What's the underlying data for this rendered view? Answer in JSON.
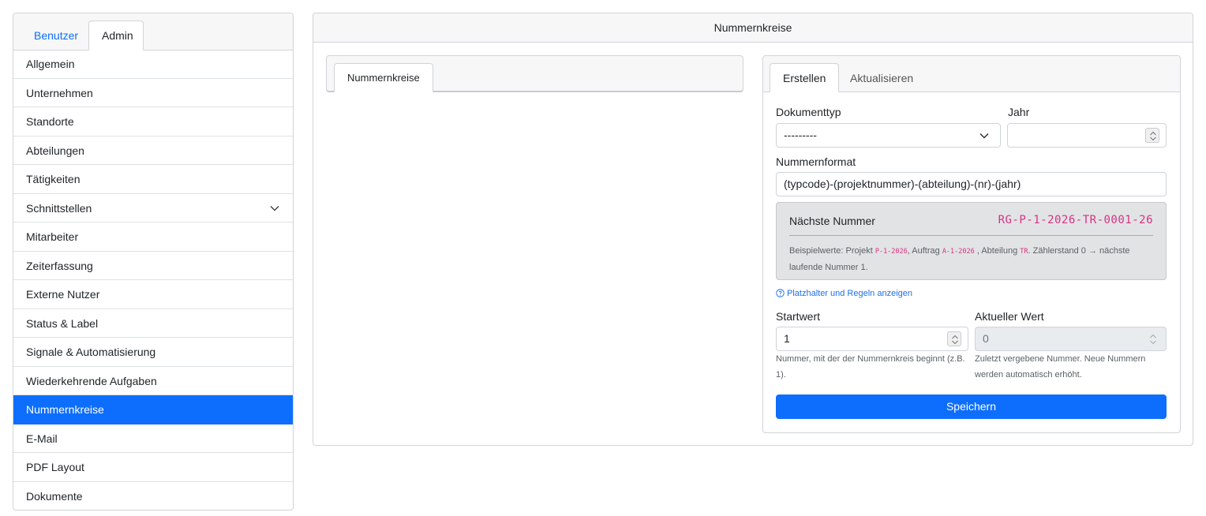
{
  "sidebar": {
    "tabs": [
      {
        "label": "Benutzer",
        "active": false
      },
      {
        "label": "Admin",
        "active": true
      }
    ],
    "items": [
      {
        "label": "Allgemein"
      },
      {
        "label": "Unternehmen"
      },
      {
        "label": "Standorte"
      },
      {
        "label": "Abteilungen"
      },
      {
        "label": "Tätigkeiten"
      },
      {
        "label": "Schnittstellen",
        "icon": "chevron-down-icon"
      },
      {
        "label": "Mitarbeiter"
      },
      {
        "label": "Zeiterfassung"
      },
      {
        "label": "Externe Nutzer"
      },
      {
        "label": "Status & Label"
      },
      {
        "label": "Signale & Automatisierung"
      },
      {
        "label": "Wiederkehrende Aufgaben"
      },
      {
        "label": "Nummernkreise",
        "active": true
      },
      {
        "label": "E-Mail"
      },
      {
        "label": "PDF Layout"
      },
      {
        "label": "Dokumente"
      }
    ]
  },
  "main": {
    "title": "Nummernkreise",
    "left_tab": "Nummernkreise",
    "form_tabs": [
      {
        "label": "Erstellen",
        "active": true
      },
      {
        "label": "Aktualisieren",
        "active": false
      }
    ],
    "form": {
      "doctype_label": "Dokumenttyp",
      "doctype_value": "---------",
      "year_label": "Jahr",
      "year_value": "",
      "format_label": "Nummernformat",
      "format_value": "(typcode)-(projektnummer)-(abteilung)-(nr)-(jahr)",
      "preview_title": "Nächste Nummer",
      "preview_value": "RG-P-1-2026-TR-0001-26",
      "note_prefix": "Beispielwerte: Projekt ",
      "note_project": "P-1-2026",
      "note_mid1": ", Auftrag ",
      "note_order": "A-1-2026",
      "note_mid2": " , Abteilung ",
      "note_dept": "TR",
      "note_suffix": ". Zählerstand 0 → nächste laufende Nummer 1.",
      "help_link": "Platzhalter und Regeln anzeigen",
      "start_label": "Startwert",
      "start_value": "1",
      "start_hint": "Nummer, mit der der Nummernkreis beginnt (z.B. 1).",
      "current_label": "Aktueller Wert",
      "current_value": "0",
      "current_hint": "Zuletzt vergebene Nummer. Neue Nummern werden automatisch erhöht.",
      "save_label": "Speichern"
    }
  },
  "colors": {
    "accent": "#0d6efd",
    "code": "#d63384",
    "preview_bg": "#e2e3e5"
  }
}
